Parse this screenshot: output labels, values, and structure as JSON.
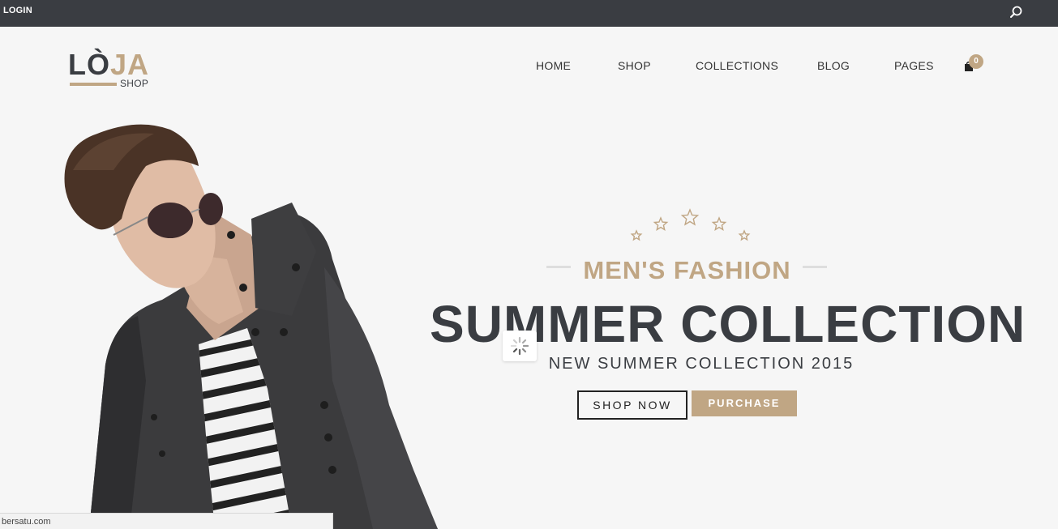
{
  "topbar": {
    "login_label": "LOGIN",
    "search_icon": "search-icon"
  },
  "logo": {
    "part1": "LÒ",
    "part2": "JA",
    "sub": "SHOP"
  },
  "nav": {
    "items": [
      "HOME",
      "SHOP",
      "COLLECTIONS",
      "BLOG",
      "PAGES"
    ]
  },
  "cart": {
    "count": "0",
    "icon": "shopping-bag-icon"
  },
  "hero": {
    "kicker": "MEN'S FASHION",
    "headline": "SUMMER COLLECTION",
    "subline": "NEW SUMMER COLLECTION 2015",
    "shop_now_label": "SHOP NOW",
    "purchase_label": "PURCHASE",
    "star_count": 5
  },
  "status": {
    "url": "bersatu.com"
  },
  "colors": {
    "accent": "#c0a684",
    "dark": "#3a3d42",
    "background": "#f6f6f6",
    "topbar": "#3a3d42"
  }
}
